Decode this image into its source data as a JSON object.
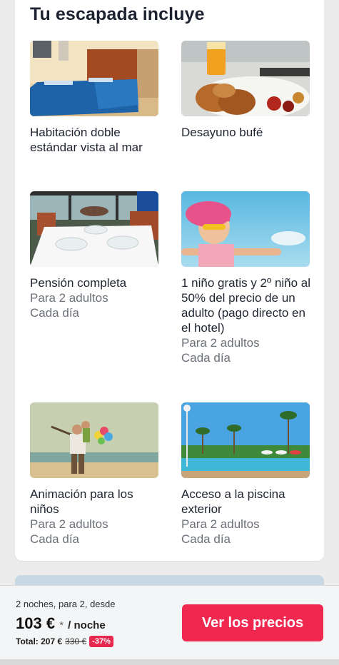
{
  "section": {
    "title": "Tu escapada incluye"
  },
  "features": [
    {
      "name": "room",
      "title": "Habitación doble estándar vista al mar",
      "lines": []
    },
    {
      "name": "breakfast",
      "title": "Desayuno bufé",
      "lines": []
    },
    {
      "name": "full-board",
      "title": "Pensión completa",
      "lines": [
        "Para 2 adultos",
        "Cada día"
      ]
    },
    {
      "name": "child-free",
      "title": "1 niño gratis y 2º niño al 50% del precio de un adulto (pago directo en el hotel)",
      "lines": [
        "Para 2 adultos",
        "Cada día"
      ]
    },
    {
      "name": "kids-entertainment",
      "title": "Animación para los niños",
      "lines": [
        "Para 2 adultos",
        "Cada día"
      ]
    },
    {
      "name": "pool",
      "title": "Acceso a la piscina exterior",
      "lines": [
        "Para 2 adultos",
        "Cada día"
      ]
    }
  ],
  "booking": {
    "nights_text": "2 noches, para 2, desde",
    "price": "103 €",
    "price_star": "*",
    "price_unit": "/ noche",
    "total_label": "Total: 207 €",
    "total_old": "330 €",
    "discount": "-37%",
    "cta_label": "Ver los precios"
  },
  "colors": {
    "accent": "#f0284f",
    "discount": "#e8294f"
  }
}
